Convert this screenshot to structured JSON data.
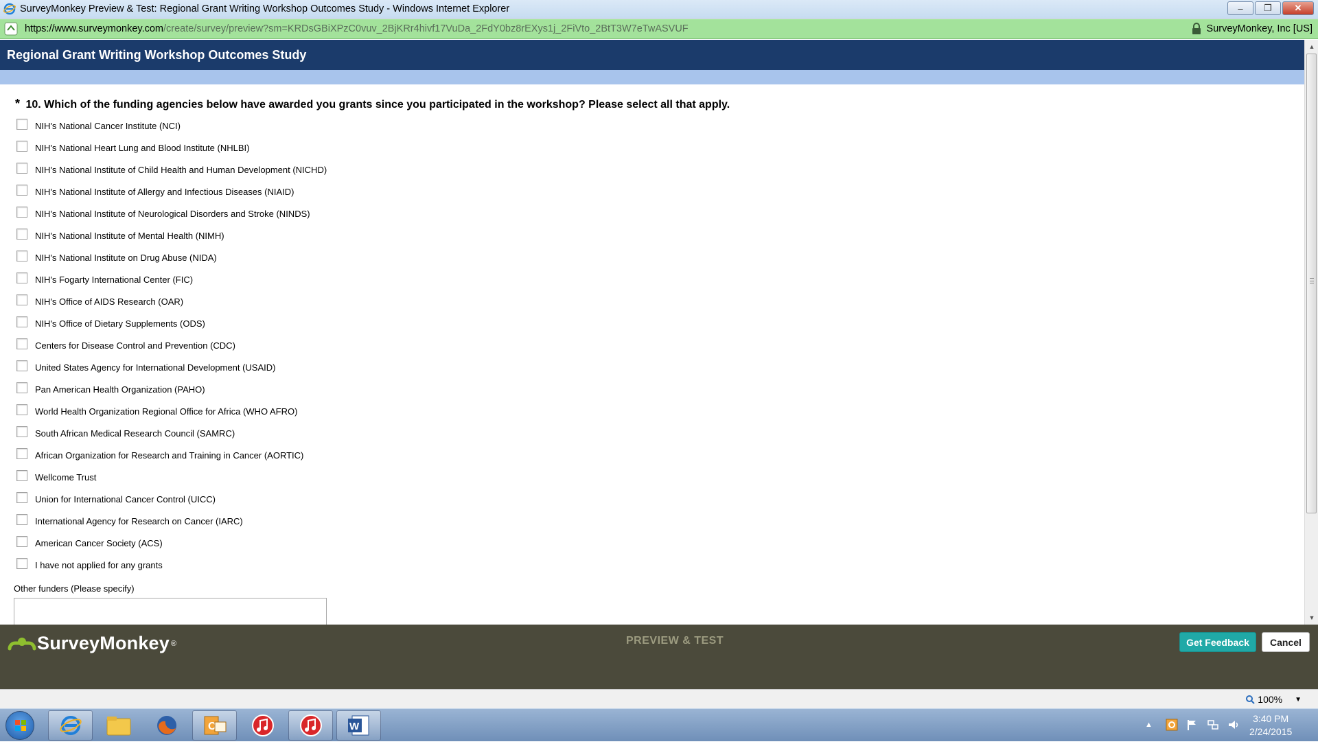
{
  "window": {
    "title": "SurveyMonkey Preview & Test: Regional Grant Writing Workshop Outcomes Study - Windows Internet Explorer",
    "controls": {
      "minimize": "–",
      "restore": "❐",
      "close": "✕"
    }
  },
  "address": {
    "url_host": "https://www.surveymonkey.com",
    "url_path": "/create/survey/preview?sm=KRDsGBiXPzC0vuv_2BjKRr4hivf17VuDa_2FdY0bz8rEXys1j_2FiVto_2BtT3W7eTwASVUF",
    "certificate": "SurveyMonkey, Inc [US]"
  },
  "survey": {
    "title": "Regional Grant Writing Workshop Outcomes Study",
    "question": {
      "required_marker": "*",
      "text": "10. Which of the funding agencies below have awarded you grants since you participated in the workshop? Please select all that apply."
    },
    "options": [
      "NIH's National Cancer Institute (NCI)",
      "NIH's National Heart Lung and Blood Institute (NHLBI)",
      "NIH's National Institute of Child Health and Human Development (NICHD)",
      "NIH's National Institute of Allergy and Infectious Diseases (NIAID)",
      "NIH's National Institute of Neurological Disorders and Stroke (NINDS)",
      "NIH's National Institute of Mental Health (NIMH)",
      "NIH's National Institute on Drug Abuse (NIDA)",
      "NIH's Fogarty International Center (FIC)",
      "NIH's Office of AIDS Research (OAR)",
      "NIH's Office of Dietary Supplements (ODS)",
      "Centers for Disease Control and Prevention (CDC)",
      "United States Agency for International Development (USAID)",
      "Pan American Health Organization (PAHO)",
      "World Health Organization Regional Office for Africa (WHO AFRO)",
      "South African Medical Research Council (SAMRC)",
      "African Organization for Research and Training in Cancer (AORTIC)",
      "Wellcome Trust",
      "Union for International Cancer Control (UICC)",
      "International Agency for Research on Cancer (IARC)",
      "American Cancer Society (ACS)",
      "I have not applied for any grants"
    ],
    "other_label": "Other funders (Please specify)",
    "other_value": ""
  },
  "footer": {
    "logo_text": "SurveyMonkey",
    "logo_mark": "®",
    "mode_label": "PREVIEW & TEST",
    "feedback_button": "Get Feedback",
    "cancel_button": "Cancel"
  },
  "statusbar": {
    "zoom": "100%",
    "zoom_caret": "▼"
  },
  "taskbar": {
    "clock_time": "3:40 PM",
    "clock_date": "2/24/2015",
    "tray_arrow": "▲",
    "apps": [
      "internet-explorer",
      "file-explorer",
      "firefox",
      "outlook",
      "itunes",
      "itunes",
      "word"
    ]
  },
  "colors": {
    "header_bg": "#1b3b6b",
    "subheader_bg": "#a8c4ec",
    "address_bg": "#a3e29b",
    "footer_bg": "#4b4a3b",
    "feedback_bg": "#20a9a7",
    "logo_green": "#8fbf2f"
  }
}
